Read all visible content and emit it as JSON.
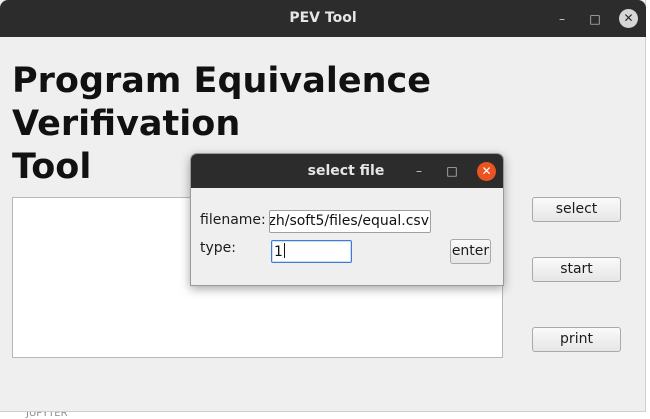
{
  "window": {
    "title": "PEV Tool",
    "minimize_glyph": "–",
    "maximize_glyph": "□",
    "close_glyph": "✕"
  },
  "heading": {
    "line1": "Program Equivalence",
    "line2": "Verifivation",
    "line3": "Tool"
  },
  "buttons": {
    "select": "select",
    "start": "start",
    "print": "print"
  },
  "dialog": {
    "title": "select file",
    "filename_label": "filename:",
    "filename_value": "zh/soft5/files/equal.csv",
    "type_label": "type:",
    "type_value": "1",
    "enter_label": "enter",
    "minimize_glyph": "–",
    "maximize_glyph": "□",
    "close_glyph": "✕",
    "close_color": "#e95420"
  },
  "background": {
    "bottom_fragment": "JUPYTER"
  }
}
